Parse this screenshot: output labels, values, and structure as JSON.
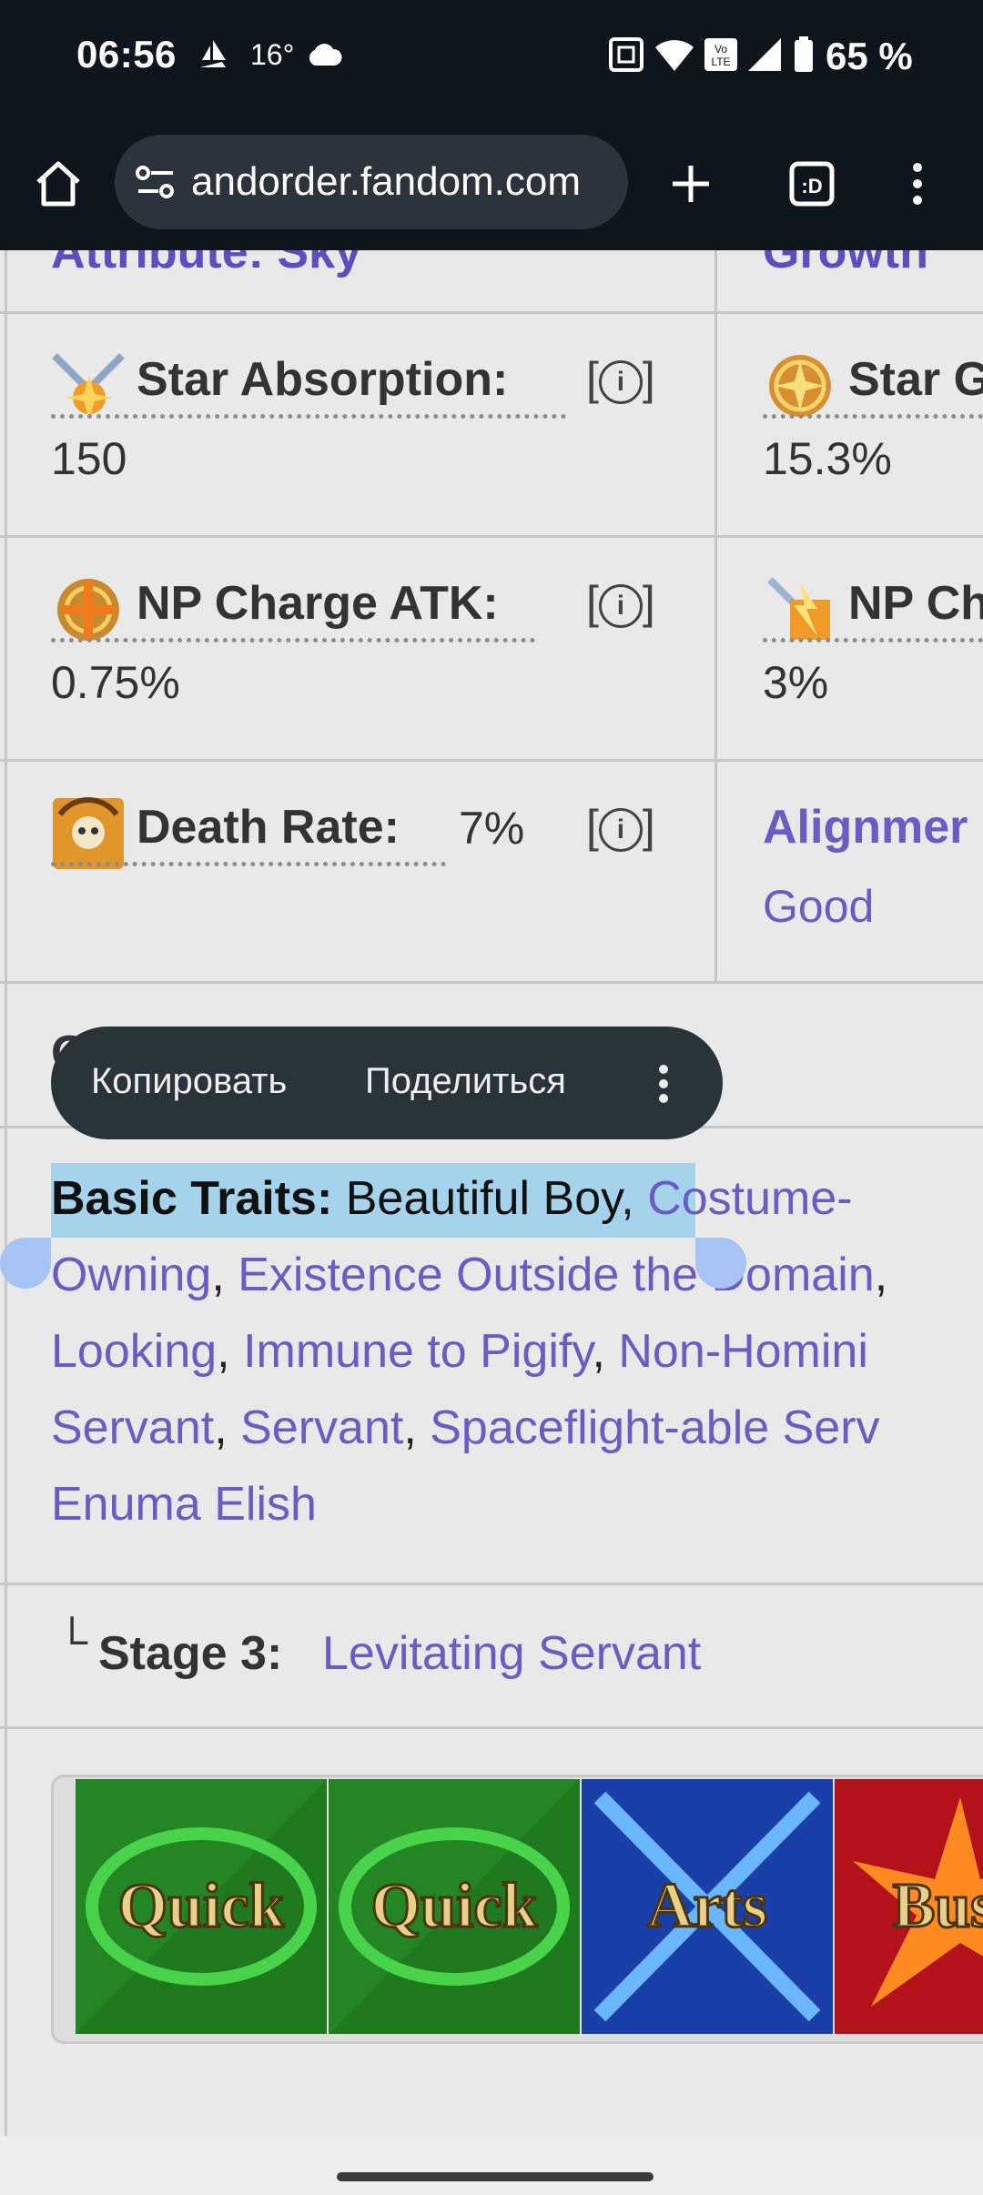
{
  "status_bar": {
    "time": "06:56",
    "temperature": "16°",
    "battery": "65 %"
  },
  "browser": {
    "url": "andorder.fandom.com"
  },
  "table": {
    "star_absorption": {
      "label": "Star Absorption:",
      "value": "150"
    },
    "star_gen_partial": {
      "label": "Star G",
      "value": "15.3%"
    },
    "np_charge_atk": {
      "label": "NP Charge ATK:",
      "value": "0.75%"
    },
    "np_charge_def_partial": {
      "label": "NP Ch",
      "value": "3%"
    },
    "death_rate": {
      "label": "Death Rate:",
      "value": "7%"
    },
    "alignment": {
      "label": "Alignmer",
      "value": "Good"
    },
    "info_marker": "i",
    "top_left_partial": "Attribute: Sky",
    "top_right_partial": "Growth"
  },
  "context_menu": {
    "copy": "Копировать",
    "share": "Поделиться"
  },
  "traits": {
    "label": "Basic Traits:",
    "selected_text": "Beautiful Boy",
    "items": [
      "Costume-Owning",
      "Existence Outside the Domain",
      "Looking",
      "Immune to Pigify",
      "Non-Homini",
      "Servant",
      "Servant",
      "Spaceflight-able Serv",
      "Enuma Elish"
    ],
    "line1_link": "Costume-",
    "line2_link_a": "Owning",
    "line2_link_b": "Existence Outside the Domain",
    "line3_link_a": "Looking",
    "line3_link_b": "Immune to Pigify",
    "line3_link_c": "Non-Homini",
    "line4_link_a": "Servant",
    "line4_link_b": "Servant",
    "line4_link_c": "Spaceflight-able Serv",
    "line5_link": "Enuma Elish"
  },
  "stage3": {
    "marker": "└",
    "label": "Stage 3:",
    "value": "Levitating Servant"
  },
  "cards": [
    {
      "label": "Quick",
      "color": "#1f7a1f"
    },
    {
      "label": "Quick",
      "color": "#1f7a1f"
    },
    {
      "label": "Arts",
      "color": "#1a3fa8"
    },
    {
      "label": "Bus",
      "color": "#b3121a"
    }
  ]
}
